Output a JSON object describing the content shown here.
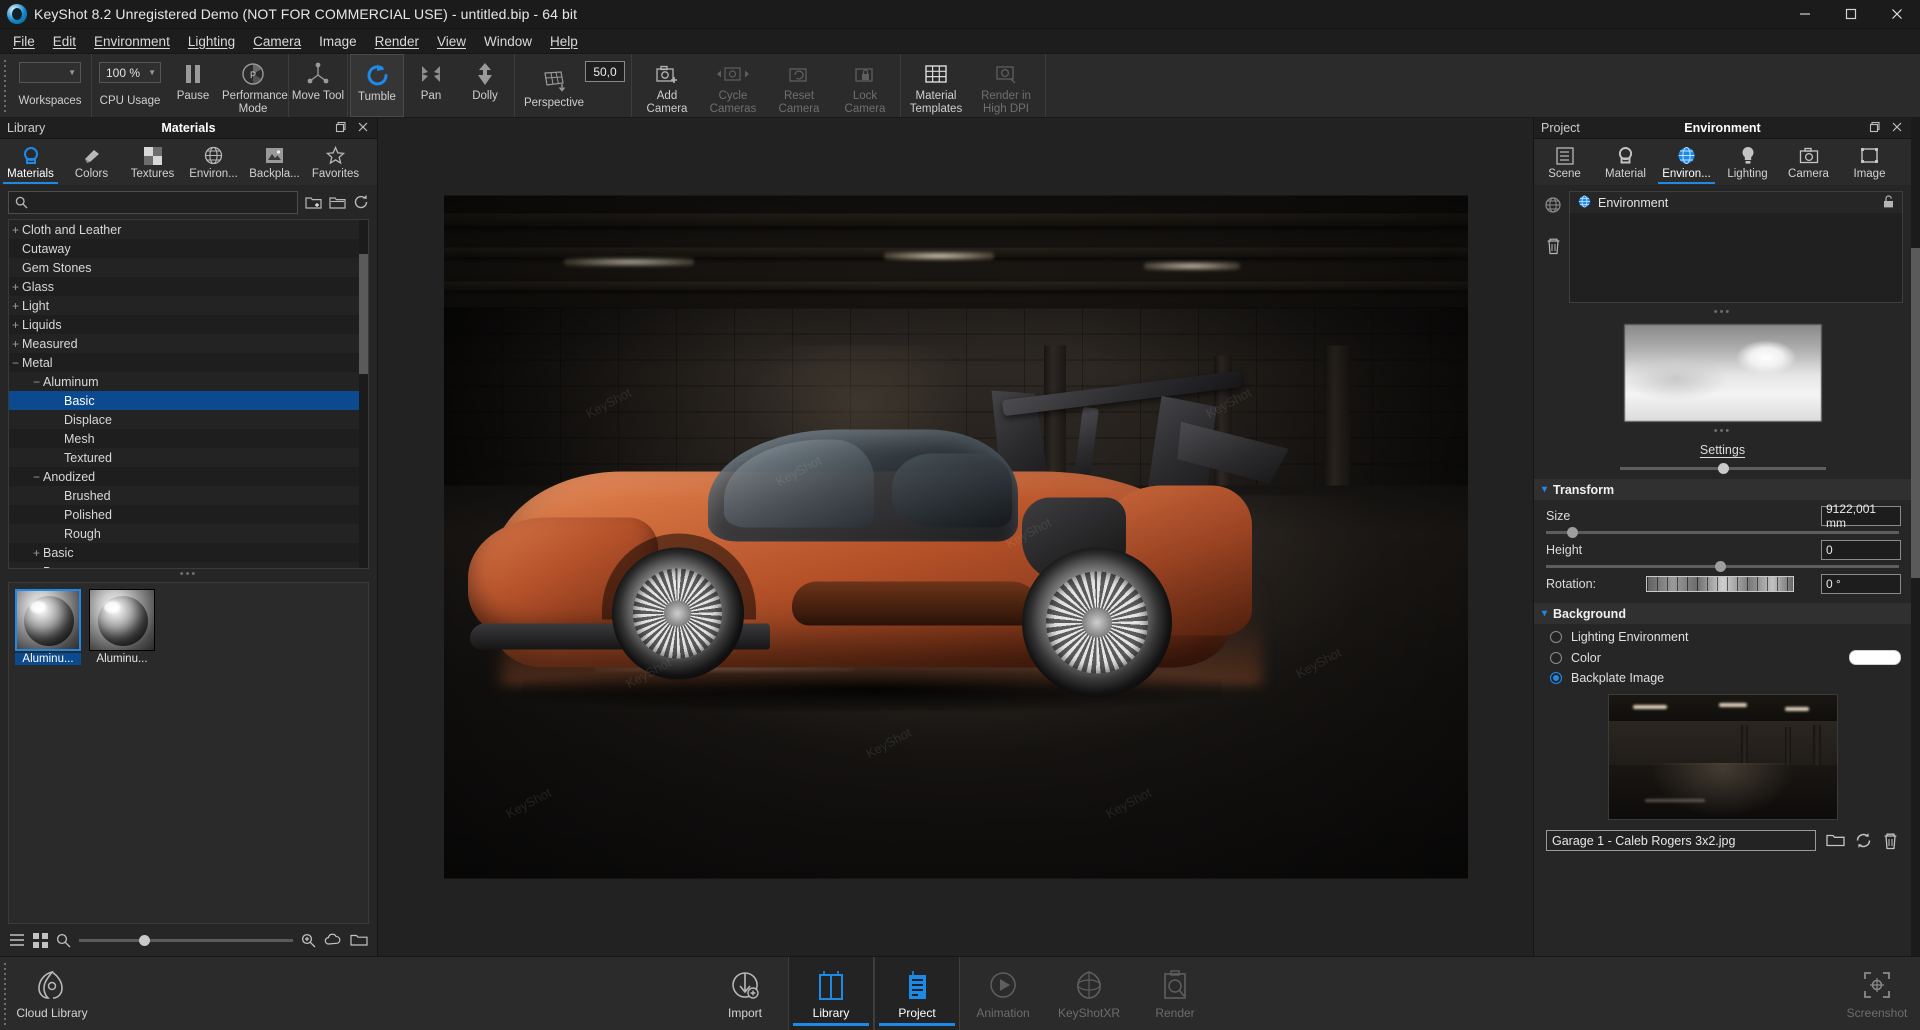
{
  "window": {
    "title": "KeyShot 8.2 Unregistered Demo (NOT FOR COMMERCIAL USE) - untitled.bip  - 64 bit",
    "logo_icon": "keyshot-logo-icon",
    "minimize_icon": "minimize-icon",
    "maximize_icon": "maximize-icon",
    "close_icon": "close-icon"
  },
  "menubar": {
    "items": [
      {
        "label": "File"
      },
      {
        "label": "Edit"
      },
      {
        "label": "Environment"
      },
      {
        "label": "Lighting"
      },
      {
        "label": "Camera"
      },
      {
        "label": "Image"
      },
      {
        "label": "Render"
      },
      {
        "label": "View"
      },
      {
        "label": "Window"
      },
      {
        "label": "Help"
      }
    ]
  },
  "toolbar": {
    "workspaces": {
      "label": "Workspaces",
      "value": "",
      "icon": "dropdown-icon"
    },
    "cpu_usage": {
      "label": "CPU Usage",
      "value": "100 %",
      "icon": "dropdown-icon"
    },
    "pause": {
      "label": "Pause",
      "icon": "pause-icon"
    },
    "performance_mode": {
      "label": "Performance Mode",
      "icon": "aperture-icon"
    },
    "move_tool": {
      "label": "Move Tool",
      "icon": "move-gizmo-icon"
    },
    "tumble": {
      "label": "Tumble",
      "icon": "tumble-rotate-icon",
      "active": true
    },
    "pan": {
      "label": "Pan",
      "icon": "pan-arrows-icon"
    },
    "dolly": {
      "label": "Dolly",
      "icon": "dolly-arrow-icon"
    },
    "perspective": {
      "label": "Perspective",
      "icon": "perspective-grid-icon",
      "value": "50,0"
    },
    "add_camera": {
      "label": "Add Camera",
      "icon": "camera-plus-icon"
    },
    "cycle_cameras": {
      "label": "Cycle Cameras",
      "icon": "camera-cycle-icon",
      "disabled": true
    },
    "reset_camera": {
      "label": "Reset Camera",
      "icon": "camera-reset-icon",
      "disabled": true
    },
    "lock_camera": {
      "label": "Lock Camera",
      "icon": "camera-lock-icon",
      "disabled": true
    },
    "material_templates": {
      "label": "Material Templates",
      "icon": "grid-templates-icon"
    },
    "render_in_high_dpi": {
      "label": "Render in High DPI",
      "icon": "render-dpi-icon",
      "disabled": true
    }
  },
  "library": {
    "header_left": "Library",
    "header_center": "Materials",
    "header_restore_icon": "restore-window-icon",
    "header_close_icon": "close-icon",
    "tabs": [
      {
        "label": "Materials",
        "icon": "material-ball-icon",
        "selected": true
      },
      {
        "label": "Colors",
        "icon": "color-swatch-icon",
        "selected": false
      },
      {
        "label": "Textures",
        "icon": "checker-texture-icon",
        "selected": false
      },
      {
        "label": "Environ...",
        "icon": "globe-icon",
        "selected": false
      },
      {
        "label": "Backpla...",
        "icon": "image-icon",
        "selected": false
      },
      {
        "label": "Favorites",
        "icon": "star-icon",
        "selected": false
      }
    ],
    "search": {
      "value": "",
      "placeholder": "",
      "icon": "search-icon"
    },
    "search_actions": [
      {
        "icon": "add-folder-icon"
      },
      {
        "icon": "open-folder-icon"
      },
      {
        "icon": "refresh-icon"
      }
    ],
    "tree": [
      {
        "label": "Cloth and Leather",
        "indent": 1,
        "toggle": "+"
      },
      {
        "label": "Cutaway",
        "indent": 1,
        "toggle": ""
      },
      {
        "label": "Gem Stones",
        "indent": 1,
        "toggle": ""
      },
      {
        "label": "Glass",
        "indent": 1,
        "toggle": "+"
      },
      {
        "label": "Light",
        "indent": 1,
        "toggle": "+"
      },
      {
        "label": "Liquids",
        "indent": 1,
        "toggle": "+"
      },
      {
        "label": "Measured",
        "indent": 1,
        "toggle": "+"
      },
      {
        "label": "Metal",
        "indent": 1,
        "toggle": "−"
      },
      {
        "label": "Aluminum",
        "indent": 2,
        "toggle": "−"
      },
      {
        "label": "Basic",
        "indent": 3,
        "toggle": "",
        "selected": true
      },
      {
        "label": "Displace",
        "indent": 3,
        "toggle": ""
      },
      {
        "label": "Mesh",
        "indent": 3,
        "toggle": ""
      },
      {
        "label": "Textured",
        "indent": 3,
        "toggle": ""
      },
      {
        "label": "Anodized",
        "indent": 2,
        "toggle": "−"
      },
      {
        "label": "Brushed",
        "indent": 3,
        "toggle": ""
      },
      {
        "label": "Polished",
        "indent": 3,
        "toggle": ""
      },
      {
        "label": "Rough",
        "indent": 3,
        "toggle": ""
      },
      {
        "label": "Basic",
        "indent": 2,
        "toggle": "+"
      },
      {
        "label": "Brass",
        "indent": 2,
        "toggle": "+"
      }
    ],
    "thumbnails": [
      {
        "caption": "Aluminu...",
        "selected": true
      },
      {
        "caption": "Aluminu...",
        "selected": false
      }
    ],
    "footer": {
      "list_view_icon": "list-view-icon",
      "grid_view_icon": "grid-view-icon",
      "zoom_out_icon": "zoom-out-icon",
      "zoom_in_icon": "zoom-in-icon",
      "cloud_icon": "cloud-download-icon",
      "folder_icon": "folder-open-icon"
    }
  },
  "project": {
    "header_left": "Project",
    "header_center": "Environment",
    "header_restore_icon": "restore-window-icon",
    "header_close_icon": "close-icon",
    "tabs": [
      {
        "label": "Scene",
        "icon": "scene-list-icon",
        "selected": false
      },
      {
        "label": "Material",
        "icon": "material-ball-icon",
        "selected": false
      },
      {
        "label": "Environ...",
        "icon": "globe-icon",
        "selected": true
      },
      {
        "label": "Lighting",
        "icon": "lightbulb-icon",
        "selected": false
      },
      {
        "label": "Camera",
        "icon": "camera-icon",
        "selected": false
      },
      {
        "label": "Image",
        "icon": "image-frame-icon",
        "selected": false
      }
    ],
    "side_actions": [
      {
        "icon": "add-environment-icon"
      },
      {
        "icon": "trash-icon"
      }
    ],
    "env_list": [
      {
        "label": "Environment",
        "icon": "globe-icon",
        "lock_icon": "unlock-icon"
      }
    ],
    "hdri": {
      "dots_top": "• • •",
      "dots_bottom": "• • •",
      "settings_label": "Settings"
    },
    "transform": {
      "title": "Transform",
      "chevron": "▾",
      "size": {
        "label": "Size",
        "value": "9122,001 mm"
      },
      "height": {
        "label": "Height",
        "value": "0"
      },
      "rotation": {
        "label": "Rotation:",
        "value": "0 °"
      }
    },
    "background": {
      "title": "Background",
      "chevron": "▾",
      "options": [
        {
          "label": "Lighting Environment",
          "selected": false
        },
        {
          "label": "Color",
          "selected": false,
          "swatch": "#ffffff"
        },
        {
          "label": "Backplate Image",
          "selected": true
        }
      ]
    },
    "backplate_file": {
      "value": "Garage 1 -  Caleb Rogers 3x2.jpg",
      "open_icon": "folder-open-icon",
      "refresh_icon": "refresh-icon",
      "delete_icon": "trash-icon"
    }
  },
  "bottombar": {
    "cloud_library": {
      "label": "Cloud Library",
      "icon": "cloud-library-icon"
    },
    "items": [
      {
        "label": "Import",
        "icon": "import-icon",
        "state": "normal"
      },
      {
        "label": "Library",
        "icon": "library-book-icon",
        "state": "active"
      },
      {
        "label": "Project",
        "icon": "project-panel-icon",
        "state": "active"
      },
      {
        "label": "Animation",
        "icon": "animation-play-icon",
        "state": "disabled"
      },
      {
        "label": "KeyShotXR",
        "icon": "keyshotxr-icon",
        "state": "disabled"
      },
      {
        "label": "Render",
        "icon": "render-icon",
        "state": "disabled"
      }
    ],
    "screenshot": {
      "label": "Screenshot",
      "icon": "screenshot-icon"
    }
  },
  "viewport": {
    "watermarks": [
      "KeyShot",
      "KeyShot",
      "KeyShot",
      "KeyShot",
      "KeyShot",
      "KeyShot",
      "KeyShot",
      "KeyShot",
      "KeyShot"
    ]
  },
  "colors": {
    "accent": "#1e8ae8",
    "panel_bg": "#262626",
    "toolbar_bg": "#2b2b2b",
    "selection": "#0c4a8f",
    "car_body": "#c4652f"
  }
}
